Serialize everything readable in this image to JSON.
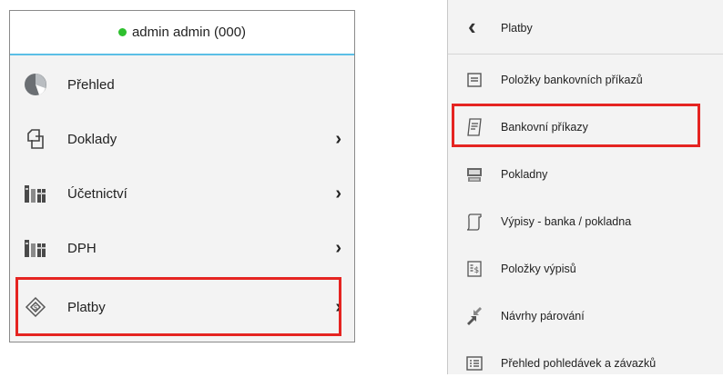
{
  "left_menu": {
    "user": "admin admin (000)",
    "status_color": "#2ec02e",
    "items": [
      {
        "label": "Přehled",
        "icon": "pie-chart-icon",
        "has_submenu": false
      },
      {
        "label": "Doklady",
        "icon": "documents-icon",
        "has_submenu": true
      },
      {
        "label": "Účetnictví",
        "icon": "books-icon",
        "has_submenu": true
      },
      {
        "label": "DPH",
        "icon": "books-icon",
        "has_submenu": true
      },
      {
        "label": "Platby",
        "icon": "payment-icon",
        "has_submenu": true,
        "highlighted": true
      }
    ]
  },
  "right_menu": {
    "title": "Platby",
    "items": [
      {
        "label": "Položky bankovních příkazů",
        "icon": "list-icon"
      },
      {
        "label": "Bankovní příkazy",
        "icon": "receipt-icon",
        "highlighted": true
      },
      {
        "label": "Pokladny",
        "icon": "cash-register-icon"
      },
      {
        "label": "Výpisy - banka / pokladna",
        "icon": "scroll-icon"
      },
      {
        "label": "Položky výpisů",
        "icon": "money-statement-icon"
      },
      {
        "label": "Návrhy párování",
        "icon": "pairing-icon"
      },
      {
        "label": "Přehled pohledávek a závazků",
        "icon": "overview-list-icon"
      }
    ]
  },
  "colors": {
    "highlight": "#e52421",
    "header_border": "#5bbfe6"
  }
}
